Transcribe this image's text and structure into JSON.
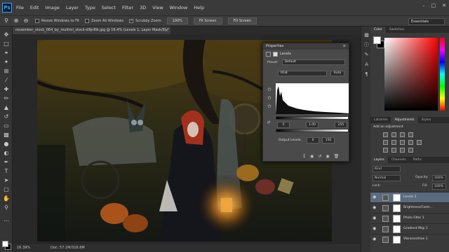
{
  "app": {
    "logo": "Ps"
  },
  "menu": [
    "File",
    "Edit",
    "Image",
    "Layer",
    "Type",
    "Select",
    "Filter",
    "3D",
    "View",
    "Window",
    "Help"
  ],
  "window_controls": [
    "–",
    "□",
    "✕"
  ],
  "options_bar": {
    "resize_windows": "Resize Windows to Fit",
    "zoom_all": "Zoom All Windows",
    "scrubby_zoom": "Scrubby Zoom",
    "zoom_pct": "100%",
    "fit_screen": "Fit Screen",
    "fill_screen": "Fill Screen",
    "workspace": "Essentials"
  },
  "document": {
    "tab_title": "november_stock_064_by_mullimi_stock-d9jn8ik.jpg @ 16.4% (Levels 1, Layer Mask/8) *",
    "zoom": "16.39%",
    "doc_size": "Doc: 57.1M/316.6M"
  },
  "properties": {
    "panel_title": "Properties",
    "adjustment": "Levels",
    "preset_label": "Preset:",
    "preset_value": "Default",
    "channel": "RGB",
    "auto": "Auto",
    "input_black": "0",
    "input_gamma": "1.00",
    "input_white": "255",
    "output_label": "Output Levels:",
    "output_black": "0",
    "output_white": "150"
  },
  "right_panels": {
    "color_tabs": [
      "Color",
      "Swatches"
    ],
    "adj_tabs": [
      "Libraries",
      "Adjustments",
      "Styles"
    ],
    "adj_title": "Add an adjustment",
    "layers_tabs": [
      "Layers",
      "Channels",
      "Paths"
    ],
    "kind": "Kind",
    "blend_mode": "Normal",
    "opacity_label": "Opacity:",
    "opacity": "100%",
    "lock_label": "Lock:",
    "fill_label": "Fill:",
    "fill": "100%",
    "layers": [
      "Levels 1",
      "Brightness/Contr...",
      "Photo Filter 1",
      "Gradient Map 1",
      "Vibrance/Hue 1"
    ]
  },
  "colors": {
    "accent": "#31a8ff",
    "selected_layer": "#5a6b80"
  },
  "icons": [
    "zoom-in-icon",
    "zoom-out-icon",
    "eye-icon",
    "eyedropper-icon",
    "gear-icon"
  ]
}
